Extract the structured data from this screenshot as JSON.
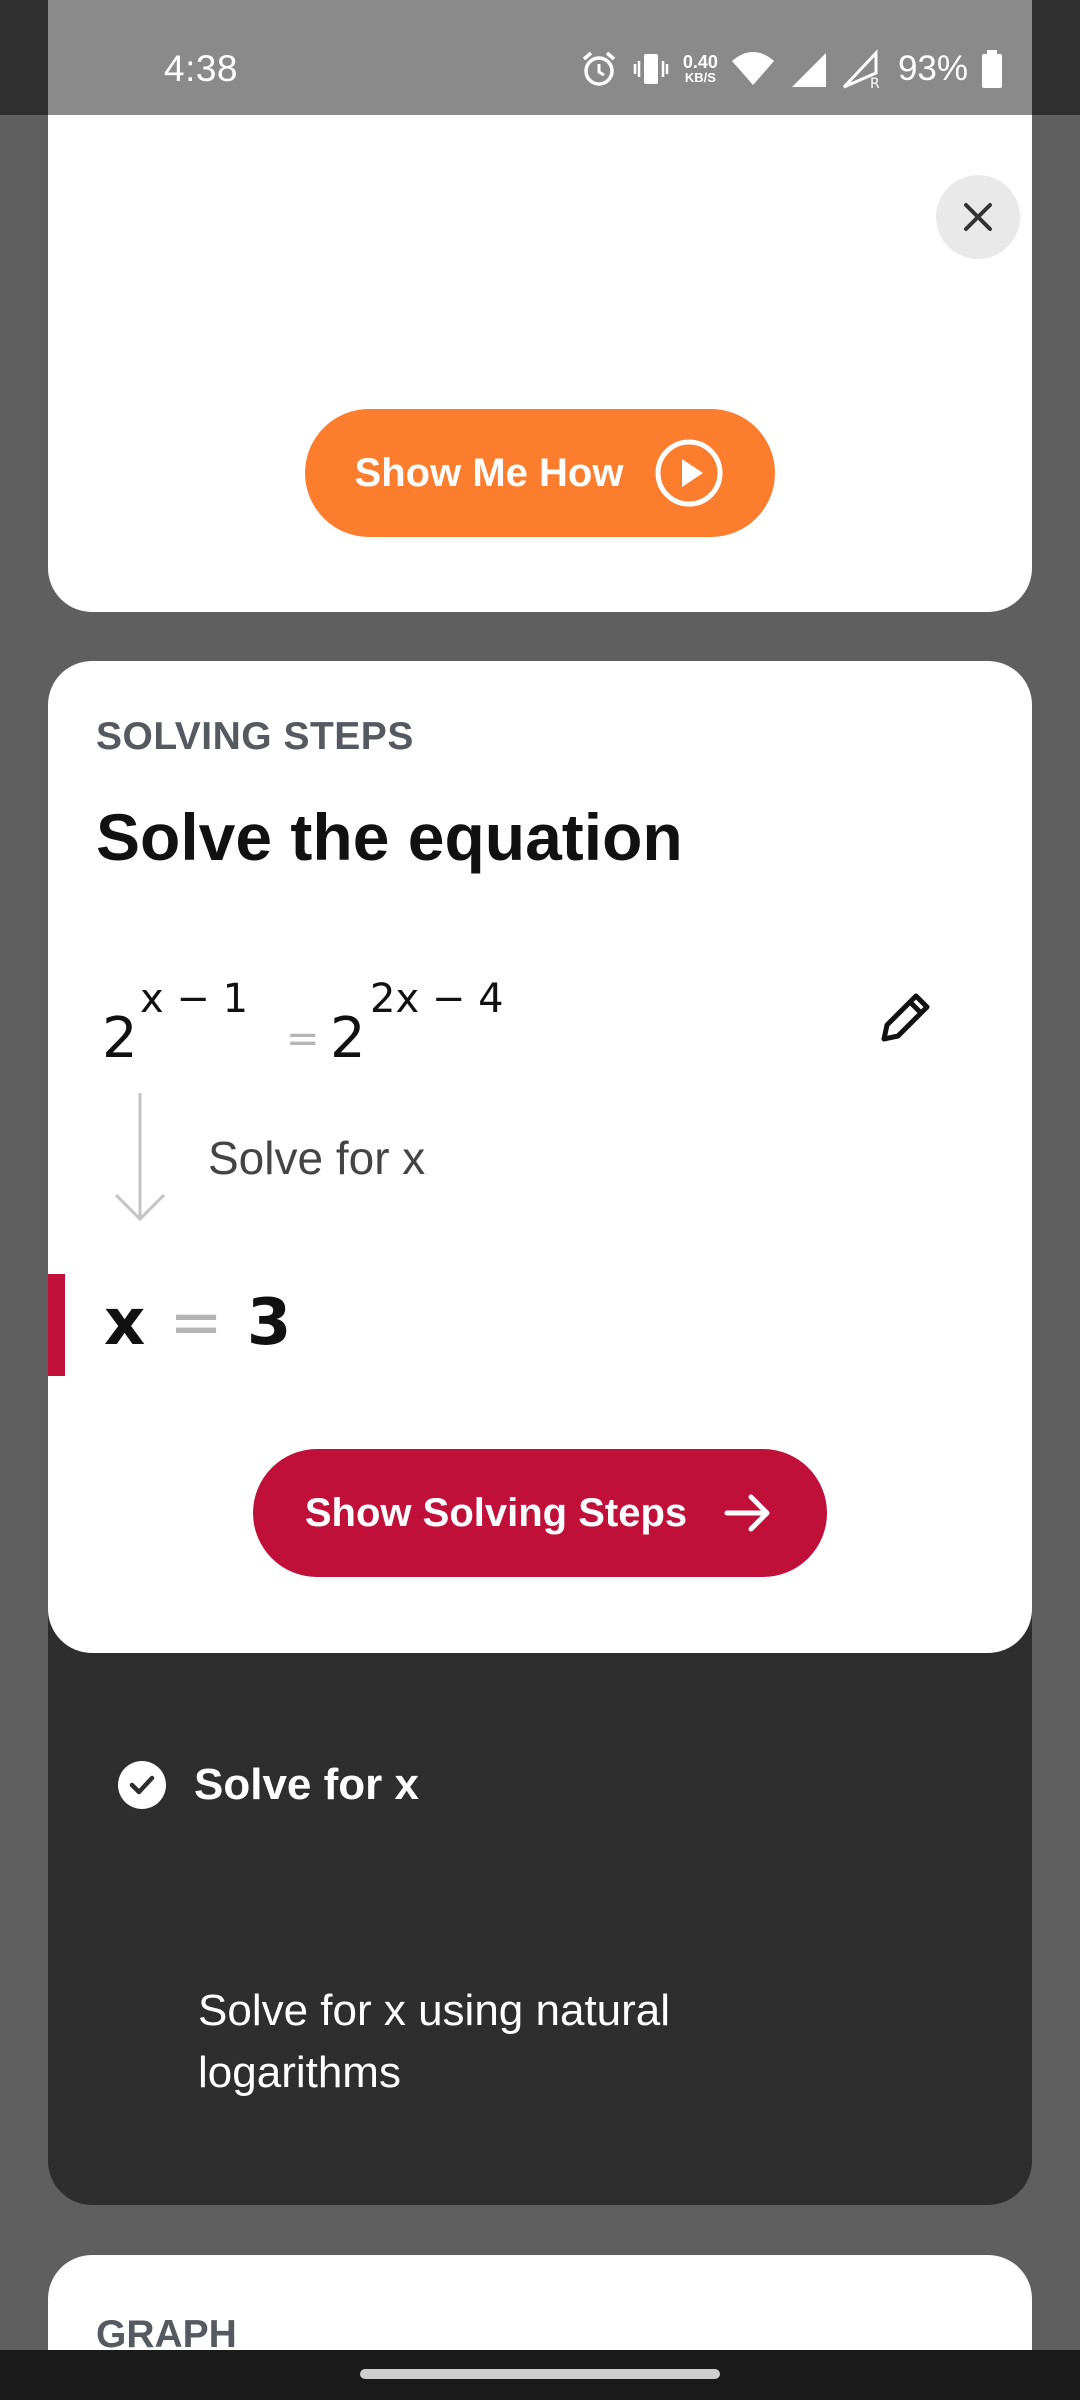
{
  "status_bar": {
    "time": "4:38",
    "net_speed_value": "0.40",
    "net_speed_unit": "KB/S",
    "battery_percent": "93%",
    "icons": [
      "alarm-icon",
      "vibrate-icon",
      "wifi-icon",
      "signal-icon",
      "signal-roaming-icon",
      "battery-icon"
    ]
  },
  "top_card": {
    "show_me_how_label": "Show Me How",
    "icons": [
      "close-icon",
      "play-circle-icon"
    ]
  },
  "solving_card": {
    "section_label": "SOLVING STEPS",
    "title": "Solve the equation",
    "equation": {
      "left_base": "2",
      "left_exponent": "x − 1",
      "equals": "=",
      "right_base": "2",
      "right_exponent": "2x − 4"
    },
    "step_description": "Solve for x",
    "result": {
      "variable": "x",
      "equals": "=",
      "value": "3"
    },
    "show_steps_label": "Show Solving Steps",
    "accent_color": "#c0103a"
  },
  "steps_panel": {
    "items": [
      {
        "label": "Solve for x",
        "checked": true
      },
      {
        "label": "Solve for x using natural logarithms",
        "checked": false
      }
    ]
  },
  "graph_card": {
    "section_label": "GRAPH"
  },
  "colors": {
    "orange_button": "#fd7d2e",
    "red_button": "#c0103a",
    "dark_panel": "#2e2e2e",
    "backdrop": "#5f5f5f"
  }
}
